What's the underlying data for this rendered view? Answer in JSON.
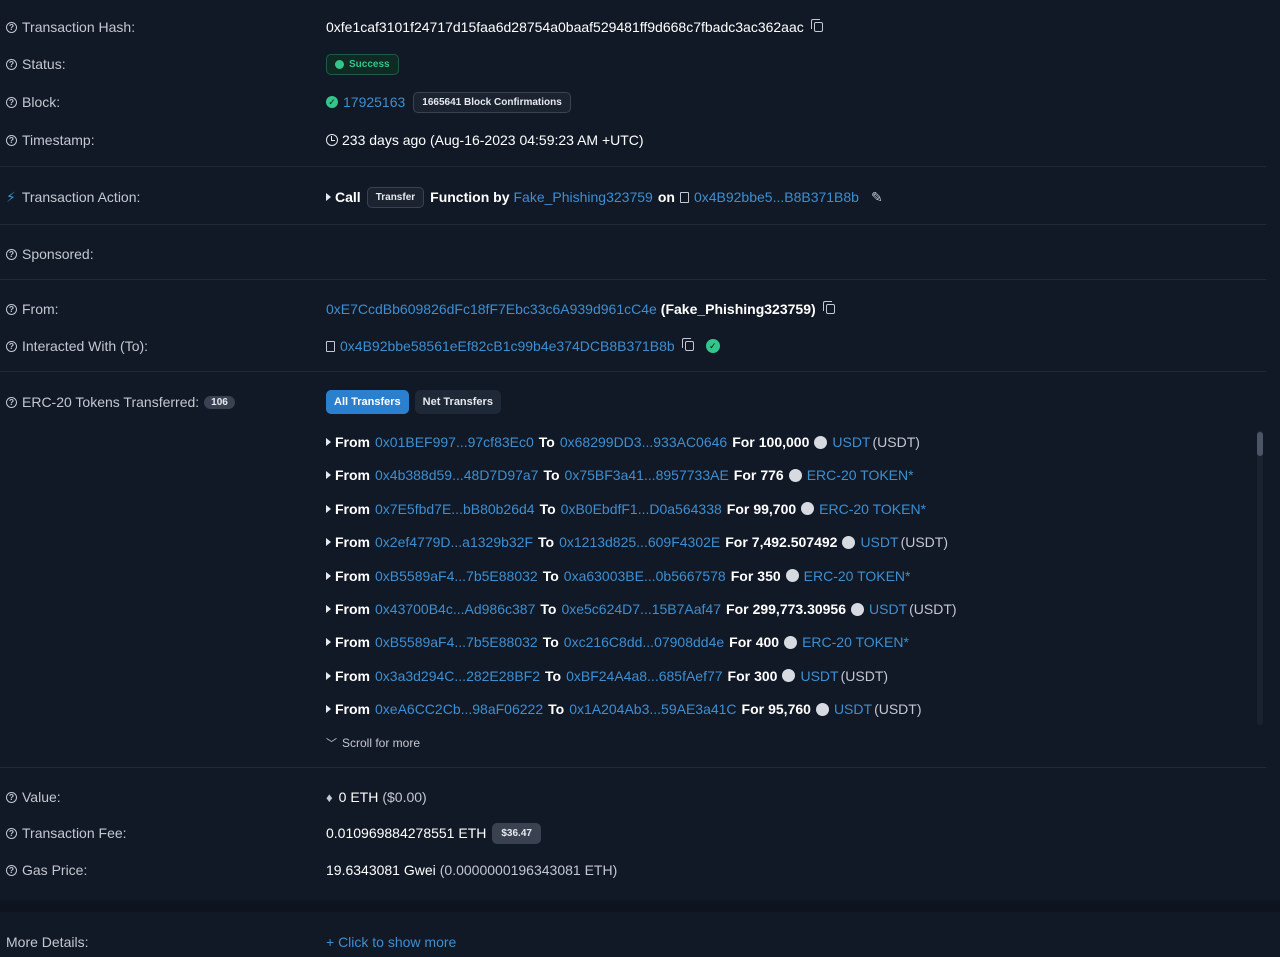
{
  "labels": {
    "tx_hash": "Transaction Hash:",
    "status": "Status:",
    "block": "Block:",
    "timestamp": "Timestamp:",
    "tx_action": "Transaction Action:",
    "sponsored": "Sponsored:",
    "from": "From:",
    "interacted_with": "Interacted With (To):",
    "erc20": "ERC-20 Tokens Transferred:",
    "value": "Value:",
    "tx_fee": "Transaction Fee:",
    "gas_price": "Gas Price:",
    "more_details": "More Details:"
  },
  "tx_hash": "0xfe1caf3101f24717d15faa6d28754a0baaf529481ff9d668c7fbadc3ac362aac",
  "status": "Success",
  "block": {
    "number": "17925163",
    "confirmations": "1665641 Block Confirmations"
  },
  "timestamp": "233 days ago (Aug-16-2023 04:59:23 AM +UTC)",
  "action": {
    "call": "Call",
    "method": "Transfer",
    "function_by": "Function by",
    "caller": "Fake_Phishing323759",
    "on": "on",
    "contract": "0x4B92bbe5...B8B371B8b"
  },
  "from": {
    "address": "0xE7CcdBb609826dFc18fF7Ebc33c6A939d961cC4e",
    "name": "(Fake_Phishing323759)"
  },
  "interacted_with": "0x4B92bbe58561eEf82cB1c99b4e374DCB8B371B8b",
  "erc20": {
    "count": "106",
    "tabs": {
      "all": "All Transfers",
      "net": "Net Transfers"
    },
    "words": {
      "from": "From",
      "to": "To",
      "for": "For"
    },
    "transfers": [
      {
        "from": "0x01BEF997...97cf83Ec0",
        "to": "0x68299DD3...933AC0646",
        "amount": "100,000",
        "token": "USDT",
        "symbol": "(USDT)"
      },
      {
        "from": "0x4b388d59...48D7D97a7",
        "to": "0x75BF3a41...8957733AE",
        "amount": "776",
        "token": "ERC-20 TOKEN*",
        "symbol": ""
      },
      {
        "from": "0x7E5fbd7E...bB80b26d4",
        "to": "0xB0EbdfF1...D0a564338",
        "amount": "99,700",
        "token": "ERC-20 TOKEN*",
        "symbol": ""
      },
      {
        "from": "0x2ef4779D...a1329b32F",
        "to": "0x1213d825...609F4302E",
        "amount": "7,492.507492",
        "token": "USDT",
        "symbol": "(USDT)"
      },
      {
        "from": "0xB5589aF4...7b5E88032",
        "to": "0xa63003BE...0b5667578",
        "amount": "350",
        "token": "ERC-20 TOKEN*",
        "symbol": ""
      },
      {
        "from": "0x43700B4c...Ad986c387",
        "to": "0xe5c624D7...15B7Aaf47",
        "amount": "299,773.30956",
        "token": "USDT",
        "symbol": "(USDT)"
      },
      {
        "from": "0xB5589aF4...7b5E88032",
        "to": "0xc216C8dd...07908dd4e",
        "amount": "400",
        "token": "ERC-20 TOKEN*",
        "symbol": ""
      },
      {
        "from": "0x3a3d294C...282E28BF2",
        "to": "0xBF24A4a8...685fAef77",
        "amount": "300",
        "token": "USDT",
        "symbol": "(USDT)"
      },
      {
        "from": "0xeA6CC2Cb...98aF06222",
        "to": "0x1A204Ab3...59AE3a41C",
        "amount": "95,760",
        "token": "USDT",
        "symbol": "(USDT)"
      }
    ],
    "scroll_more": "Scroll for more"
  },
  "value": {
    "amount": "0 ETH",
    "usd": "($0.00)"
  },
  "tx_fee": {
    "amount": "0.010969884278551 ETH",
    "usd": "$36.47"
  },
  "gas_price": {
    "gwei": "19.6343081 Gwei",
    "eth": "(0.0000000196343081 ETH)"
  },
  "more_details": "+ Click to show more",
  "colors": {
    "background": "#111826",
    "link": "#3d8fd1",
    "success": "#34c58a",
    "accent": "#2a7fce"
  }
}
